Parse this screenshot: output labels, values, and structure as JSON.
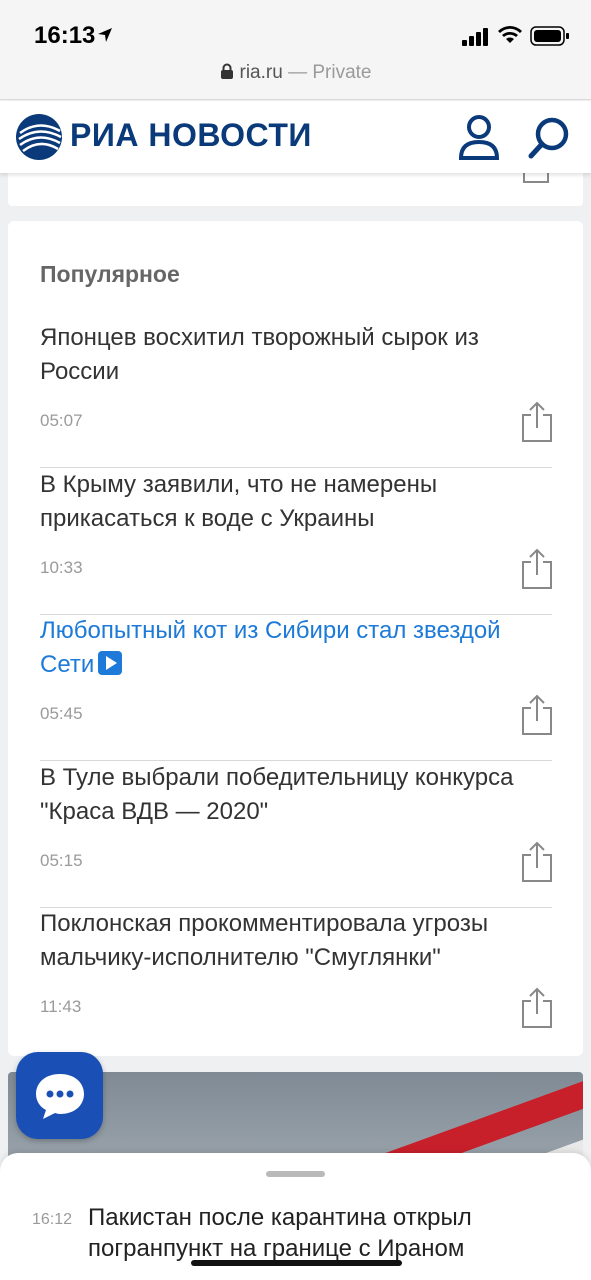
{
  "status_bar": {
    "time": "16:13",
    "url": "ria.ru",
    "private_label": "— Private"
  },
  "header": {
    "logo_text": "РИА НОВОСТИ",
    "brand_color": "#0a3a7a"
  },
  "popular": {
    "title": "Популярное",
    "items": [
      {
        "title": "Японцев восхитил творожный сырок из России",
        "time": "05:07"
      },
      {
        "title": "В Крыму заявили, что не намерены прикасаться к воде с Украины",
        "time": "10:33"
      },
      {
        "title": "Любопытный кот из Сибири стал звездой Сети",
        "time": "05:45"
      },
      {
        "title": "В Туле выбрали победительницу конкурса \"Краса ВДВ — 2020\"",
        "time": "05:15"
      },
      {
        "title": "Поклонская прокомментировала угрозы мальчику-исполнителю \"Смуглянки\"",
        "time": "11:43"
      }
    ]
  },
  "bottom_sheet": {
    "time": "16:12",
    "title": "Пакистан после карантина открыл погранпункт на границе с Ираном"
  },
  "colors": {
    "link": "#1d7ad8",
    "chat_button": "#1a4fb6"
  }
}
